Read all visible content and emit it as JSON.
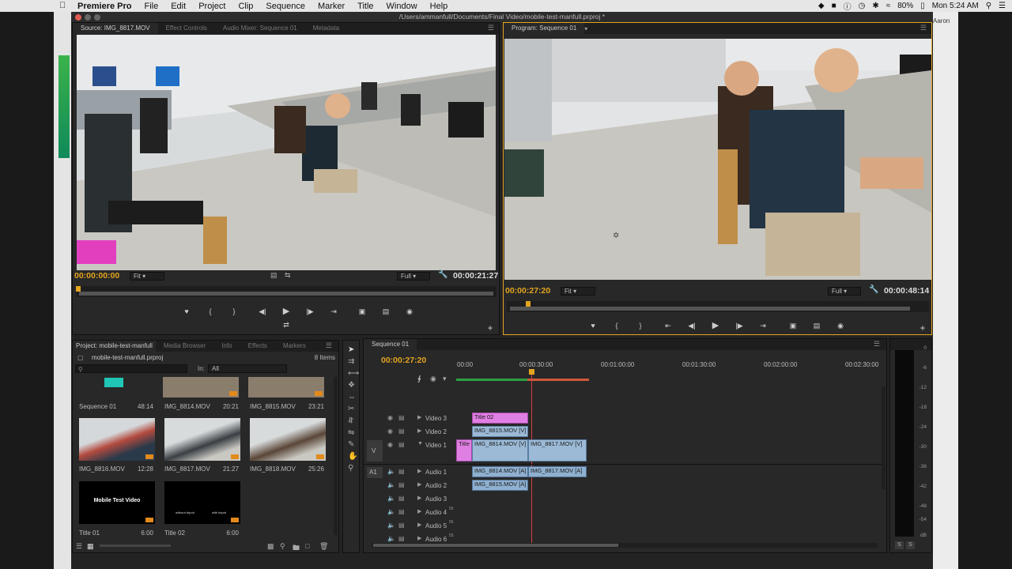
{
  "menubar": {
    "app": "Premiere Pro",
    "items": [
      "File",
      "Edit",
      "Project",
      "Clip",
      "Sequence",
      "Marker",
      "Title",
      "Window",
      "Help"
    ],
    "battery": "80%",
    "clock": "Mon 5:24 AM",
    "user": "Aaron"
  },
  "window": {
    "title": "/Users/ammanfull/Documents/Final Video/mobile-test-manfull.prproj *"
  },
  "source": {
    "tabs": [
      "Source: IMG_8817.MOV",
      "Effect Controls",
      "Audio Mixer: Sequence 01",
      "Metadata"
    ],
    "timecode_in": "00:00:00:00",
    "fit": "Fit",
    "quality": "Full",
    "duration": "00:00:21:27",
    "controls": [
      "marker",
      "mark-in",
      "mark-out",
      "step-back",
      "play",
      "step-forward",
      "go-to-out",
      "insert",
      "overwrite",
      "export-frame"
    ]
  },
  "program": {
    "tab": "Program: Sequence 01",
    "timecode": "00:00:27:20",
    "fit": "Fit",
    "quality": "Full",
    "duration": "00:00:48:14"
  },
  "project": {
    "tabs": [
      "Project: mobile-test-manfull",
      "Media Browser",
      "Info",
      "Effects",
      "Markers"
    ],
    "filename": "mobile-test-manfull.prproj",
    "count": "8 Items",
    "in_label": "In:",
    "in_value": "All",
    "items": [
      {
        "name": "Sequence 01",
        "dur": "48:14"
      },
      {
        "name": "IMG_8814.MOV",
        "dur": "20:21"
      },
      {
        "name": "IMG_8815.MOV",
        "dur": "23:21"
      },
      {
        "name": "IMG_8816.MOV",
        "dur": "12:28"
      },
      {
        "name": "IMG_8817.MOV",
        "dur": "21:27"
      },
      {
        "name": "IMG_8818.MOV",
        "dur": "25:26"
      },
      {
        "name": "Title 01",
        "dur": "6:00"
      },
      {
        "name": "Title 02",
        "dur": "6:00"
      }
    ],
    "title01_text": "Mobile Test Video",
    "title02_text": [
      "without tripod",
      "with tripod"
    ]
  },
  "timeline": {
    "tab": "Sequence 01",
    "timecode": "00:00:27:20",
    "ruler": [
      "00:00",
      "00:00:30:00",
      "00:01:00:00",
      "00:01:30:00",
      "00:02:00:00",
      "00:02:30:00"
    ],
    "tracks": {
      "video": [
        "Video 3",
        "Video 2",
        "Video 1"
      ],
      "audio": [
        "Audio 1",
        "Audio 2",
        "Audio 3",
        "Audio 4",
        "Audio 5",
        "Audio 6"
      ],
      "v_target": "V",
      "a_target": "A1",
      "audio_badge": "55"
    },
    "clips": {
      "title02": "Title 02",
      "v2": "IMG_8815.MOV [V]",
      "title_v1": "Title",
      "v1a": "IMG_8814.MOV [V]",
      "v1b": "IMG_8817.MOV [V]",
      "a1a": "IMG_8814.MOV [A]",
      "a1b": "IMG_8817.MOV [A]",
      "a2": "IMG_8815.MOV [A]"
    }
  },
  "meter": {
    "labels": [
      "0",
      "-6",
      "-12",
      "-18",
      "-24",
      "-30",
      "-36",
      "-42",
      "-48",
      "-54",
      "dB"
    ],
    "buttons": [
      "S",
      "S"
    ]
  },
  "colors": {
    "timecode": "#e3a51f",
    "video_clip": "#9cbad6",
    "title_clip": "#e07fe3",
    "playhead": "#d64040"
  }
}
